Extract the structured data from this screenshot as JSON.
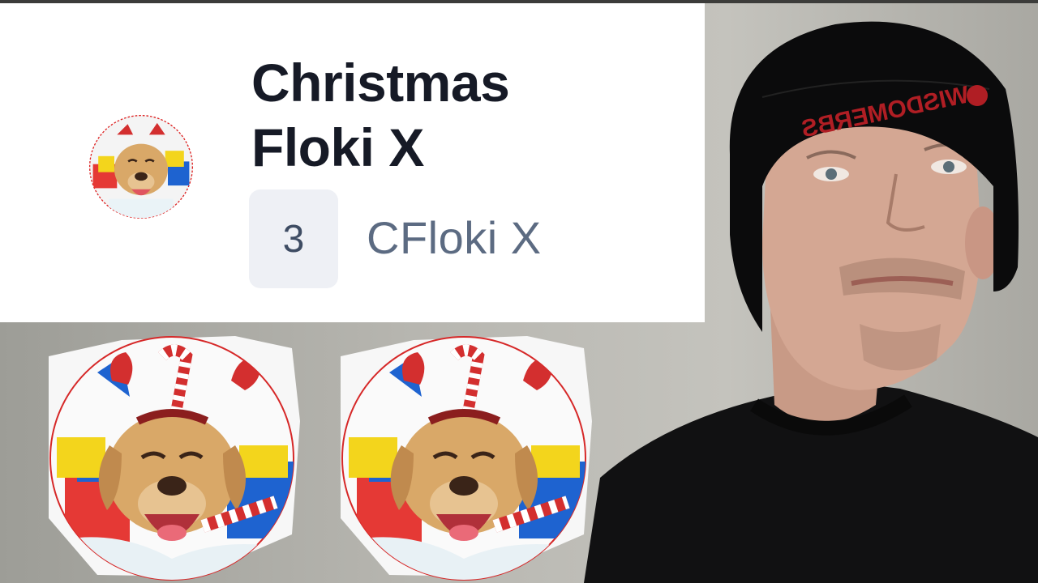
{
  "token": {
    "name_line1": "Christmas",
    "name_line2": "Floki X",
    "rank": "3",
    "symbol": "CFloki X"
  },
  "host_beanie_text": "WISDOMERBS",
  "icons": {
    "token_logo": "christmas-floki-dog-logo",
    "host": "presenter-photo"
  }
}
